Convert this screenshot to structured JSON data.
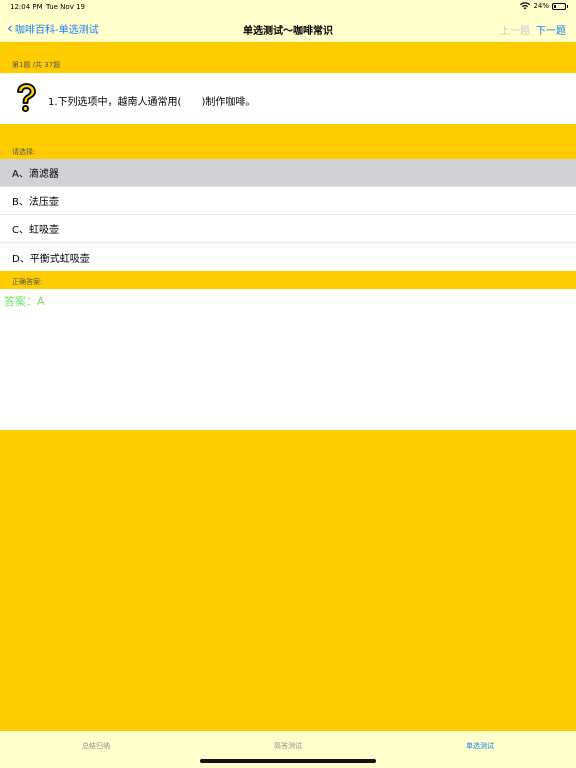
{
  "status": {
    "time": "12:04 PM",
    "date": "Tue Nov 19",
    "battery": "24%",
    "battery_level": 0.24
  },
  "nav": {
    "back_label": "咖啡百科-单选测试",
    "title": "单选测试～咖啡常识",
    "prev_label": "上一题",
    "next_label": "下一题"
  },
  "question": {
    "counter": "第1题 /共 37题",
    "text": "1.下列选项中，越南人通常用(　　)制作咖啡。"
  },
  "options_header": "请选择:",
  "options": [
    {
      "label": "A、滴滤器",
      "selected": true
    },
    {
      "label": "B、法压壶",
      "selected": false
    },
    {
      "label": "C、虹吸壶",
      "selected": false
    },
    {
      "label": "D、平衡式虹吸壶",
      "selected": false
    }
  ],
  "answer": {
    "header": "正确答案:",
    "text": "答案：A"
  },
  "tabs": [
    {
      "label": "总结归纳",
      "active": false
    },
    {
      "label": "简答测试",
      "active": false
    },
    {
      "label": "单选测试",
      "active": true
    }
  ],
  "colors": {
    "background": "#FFCC00",
    "bar": "#FFFFCC",
    "accent": "#1E7CF2",
    "answer": "#6CE26C",
    "selected_option": "#D1D1D6"
  }
}
